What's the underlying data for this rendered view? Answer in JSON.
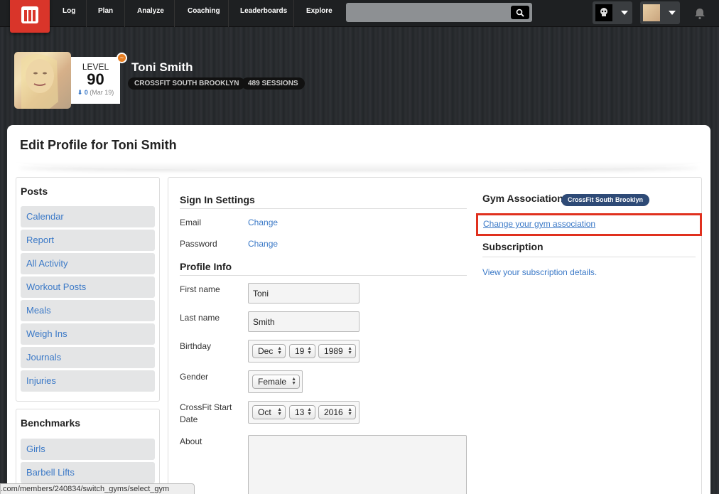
{
  "nav": {
    "items": [
      "Log",
      "Plan",
      "Analyze",
      "Coaching",
      "Leaderboards",
      "Explore"
    ],
    "search_icon": "search-icon",
    "bell_icon": "bell-icon"
  },
  "profile": {
    "name": "Toni Smith",
    "level_label": "LEVEL",
    "level": "90",
    "level_change": "0",
    "level_date": "(Mar 19)",
    "gym_pill": "CROSSFIT SOUTH BROOKLYN",
    "sessions_pill": "489 SESSIONS"
  },
  "page": {
    "title": "Edit Profile for Toni Smith"
  },
  "sidebar": {
    "posts_heading": "Posts",
    "posts": [
      "Calendar",
      "Report",
      "All Activity",
      "Workout Posts",
      "Meals",
      "Weigh Ins",
      "Journals",
      "Injuries"
    ],
    "benchmarks_heading": "Benchmarks",
    "benchmarks": [
      "Girls",
      "Barbell Lifts"
    ]
  },
  "signin": {
    "heading": "Sign In Settings",
    "email_label": "Email",
    "email_link": "Change",
    "password_label": "Password",
    "password_link": "Change"
  },
  "profile_info": {
    "heading": "Profile Info",
    "first_name_label": "First name",
    "first_name": "Toni",
    "last_name_label": "Last name",
    "last_name": "Smith",
    "birthday_label": "Birthday",
    "birthday_month": "Dec",
    "birthday_day": "19",
    "birthday_year": "1989",
    "gender_label": "Gender",
    "gender": "Female",
    "crossfit_start_label_1": "CrossFit Start",
    "crossfit_start_label_2": "Date",
    "start_month": "Oct",
    "start_day": "13",
    "start_year": "2016",
    "about_label": "About"
  },
  "gym": {
    "heading": "Gym Association",
    "badge": "CrossFit South Brooklyn",
    "change_link": "Change your gym association",
    "subscription_heading": "Subscription",
    "subscription_link": "View your subscription details."
  },
  "status_bar": {
    "url": ".com/members/240834/switch_gyms/select_gym"
  },
  "colors": {
    "accent_red": "#d9352a",
    "link_blue": "#3b79c7",
    "highlight_red": "#e0301e",
    "gym_badge": "#2e4a76"
  }
}
